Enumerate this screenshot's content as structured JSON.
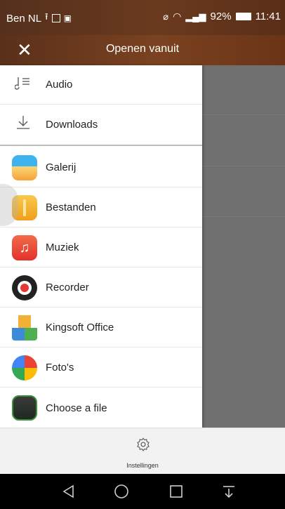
{
  "status_bar": {
    "carrier": "Ben NL",
    "battery": "92%",
    "time": "11:41"
  },
  "header": {
    "title": "Openen vanuit"
  },
  "drawer": {
    "system_items": [
      {
        "label": "Audio",
        "icon": "music-note-list-icon"
      },
      {
        "label": "Downloads",
        "icon": "download-icon"
      }
    ],
    "apps": [
      {
        "label": "Galerij",
        "icon": "gallery-app-icon",
        "color": "#f7a43a"
      },
      {
        "label": "Bestanden",
        "icon": "files-app-icon",
        "color": "#f4b12e"
      },
      {
        "label": "Muziek",
        "icon": "music-app-icon",
        "color": "#ee4b35"
      },
      {
        "label": "Recorder",
        "icon": "recorder-app-icon",
        "color": "#222222"
      },
      {
        "label": "Kingsoft Office",
        "icon": "kingsoft-office-app-icon",
        "color": "#3b8bd8"
      },
      {
        "label": "Foto's",
        "icon": "photos-app-icon",
        "color": "#34a853"
      },
      {
        "label": "Choose a file",
        "icon": "choose-file-app-icon",
        "color": "#2f3a2f"
      }
    ]
  },
  "footer": {
    "settings_label": "Instellingen"
  }
}
